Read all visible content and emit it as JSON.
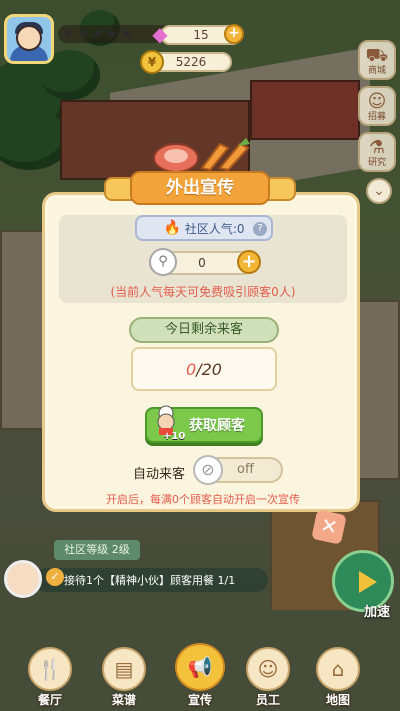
{
  "top_bar": {
    "stars_total": 5,
    "stars_filled": 0,
    "gems": "15",
    "coins": "5226"
  },
  "side_menu": {
    "shop_label": "商城",
    "recruit_label": "招募",
    "research_label": "研究"
  },
  "dialog": {
    "title": "外出宣传",
    "heat_label": "社区人气:0",
    "heat_value": "0",
    "heat_note": "(当前人气每天可免费吸引顾客0人)",
    "remaining_label": "今日剩余来客",
    "remaining_current": "0",
    "remaining_total": "/20",
    "get_button_label": "获取顾客",
    "get_bonus": "+10",
    "auto_label": "自动来客",
    "auto_state": "off",
    "auto_note": "开启后，每满0个顾客自动开启一次宣传"
  },
  "status": {
    "level": "社区等级 2级",
    "quest": "接待1个【精神小伙】顾客用餐 1/1",
    "speed_label": "加速"
  },
  "bottom_nav": [
    {
      "label": "餐厅",
      "icon": "restaurant-icon"
    },
    {
      "label": "菜谱",
      "icon": "recipe-icon"
    },
    {
      "label": "宣传",
      "icon": "megaphone-icon"
    },
    {
      "label": "员工",
      "icon": "chef-icon"
    },
    {
      "label": "地图",
      "icon": "map-icon"
    }
  ],
  "colors": {
    "accent": "#f2a43a",
    "green_button": "#7cc84a",
    "note_red": "#e25c4a"
  }
}
